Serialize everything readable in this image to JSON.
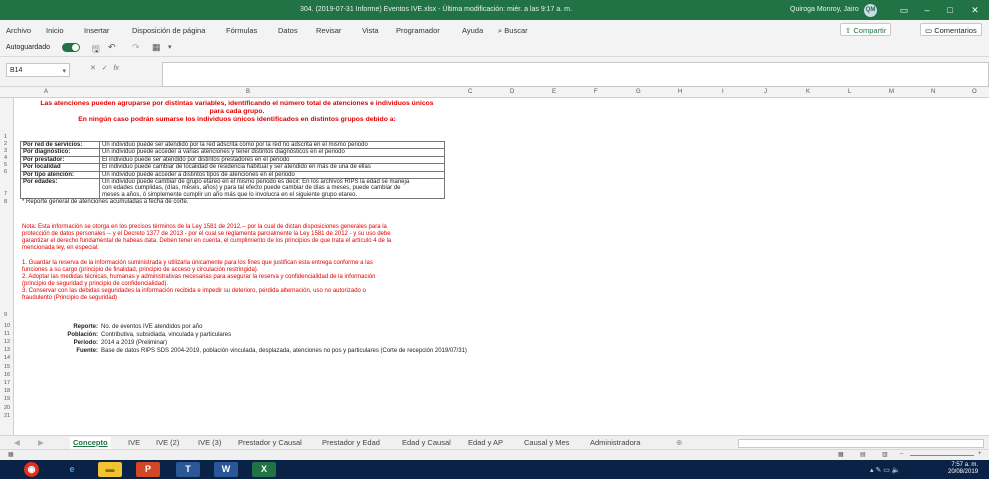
{
  "window": {
    "title": "304. (2019-07-31 Informe) Eventos IVE.xlsx  -  Última modificación: miér. a las 9:17 a. m.",
    "user": "Quiroga Monroy, Jairo",
    "user_initials": "QM"
  },
  "menu": {
    "items": [
      "Archivo",
      "Inicio",
      "Insertar",
      "Disposición de página",
      "Fórmulas",
      "Datos",
      "Revisar",
      "Vista",
      "Programador",
      "Ayuda"
    ],
    "search": "Buscar",
    "share": "Compartir",
    "comments": "Comentarios"
  },
  "qat": {
    "autosave": "Autoguardado",
    "autosave_state": "on"
  },
  "formula_bar": {
    "name_box": "B14",
    "formula": ""
  },
  "columns": [
    "A",
    "B",
    "C",
    "D",
    "E",
    "F",
    "G",
    "H",
    "I",
    "J",
    "K",
    "L",
    "M",
    "N",
    "O"
  ],
  "rows": [
    "1",
    "2",
    "3",
    "4",
    "5",
    "6",
    "7",
    "8",
    "9",
    "10",
    "11",
    "12",
    "13",
    "14",
    "15",
    "16",
    "17",
    "18",
    "19",
    "20",
    "21"
  ],
  "sheet": {
    "heading_line1": "Las atenciones pueden agruparse por distintas variables, identificando el número total de atenciones e individuos únicos",
    "heading_line2": "para cada grupo.",
    "heading_line3": "En ningún caso podrán sumarse los individuos únicos identificados en distintos grupos debido a:",
    "definitions": [
      {
        "key": "Por red de servicios:",
        "value": "Un individuo puede ser atendido por la red adscrita como por la red no adscrita en el mismo periodo"
      },
      {
        "key": "Por diagnóstico:",
        "value": "Un individuo puede acceder a varias atenciones y tener distintos diagnósticos en el periodo"
      },
      {
        "key": "Por prestador:",
        "value": "El individuo puede ser atendido por distintos prestadores en el periodo"
      },
      {
        "key": "Por localidad",
        "value": "El individuo puede cambiar de localidad de residencia habitual y ser atendido en más de una de ellas"
      },
      {
        "key": "Por tipo atención:",
        "value": "Un individuo puede acceder a distintos tipos de atenciones en el periodo"
      },
      {
        "key": "Por edades:",
        "value_lines": [
          "Un individuo puede cambiar de grupo etareo en el mismo periodo es decir: En los archivos RIPS la edad se maneja",
          "con edades cumplidas, (días, meses, años) y para tal efecto puede cambiar de días a meses, puede cambiar de",
          "meses a años, ó simplemente cumplir un año más que lo involucra en el siguiente grupo etareo."
        ]
      }
    ],
    "footnote": "* Reporte general de atenciones acumuladas a fecha de corte.",
    "note_lines": [
      "Nota: Esta información se otorga en los precisos términos de la Ley 1581 de 2012,-- por la cual de dictan disposiciones generales para la",
      "protección de datos personales -- y el Decreto 1377 de 2013 - por el cual se reglamenta parcialmente la Ley 1581 de 2012 - y su uso debe",
      "garantizar el derecho fundamental de habeas data. Deben tener en cuenta, el cumplimiento de los principios de que trata el artículo 4 de la",
      "mencionada ley, en especial:"
    ],
    "item_lines": [
      "1. Guardar la reserva de la información suministrada y utilizarla únicamente para los fines que justifican esta entrega conforme a las",
      "funciones a su cargo (principio de finalidad, principio de acceso y circulación restringida).",
      "2. Adoptar las medidas técnicas, humanas y administrativas necesarias para asegurar la reserva y confidencialidad de la información",
      "(principio de seguridad y principio de confidencialidad).",
      "3. Conservar con las debidas seguridades la información recibida e impedir su deterioro, pérdida alternación, uso no autorizado o",
      "fraudulento (Principio de seguridad)"
    ],
    "report": [
      {
        "label": "Reporte:",
        "value": "No. de eventos IVE atendidos por año"
      },
      {
        "label": "Población:",
        "value": "Contributiva, subsidiada, vinculada y particulares"
      },
      {
        "label": "Periodo:",
        "value": "2014 a 2019 (Preliminar)"
      },
      {
        "label": "Fuente:",
        "value": "Base de datos RIPS SDS 2004-2019, población vinculada, desplazada, atenciones no pos y particulares (Corte de recepción 2019/07/31)"
      }
    ]
  },
  "tabs": [
    "Concepto",
    "IVE",
    "IVE (2)",
    "IVE (3)",
    "Prestador y Causal",
    "Prestador y Edad",
    "Edad y Causal",
    "Edad y AP",
    "Causal y Mes",
    "Administradora"
  ],
  "active_tab": "Concepto",
  "taskbar": {
    "time": "7:57 a. m.",
    "date": "20/08/2019"
  },
  "colors": {
    "excel_green": "#217346",
    "red_text": "#e00000",
    "taskbar": "#0b2247"
  }
}
